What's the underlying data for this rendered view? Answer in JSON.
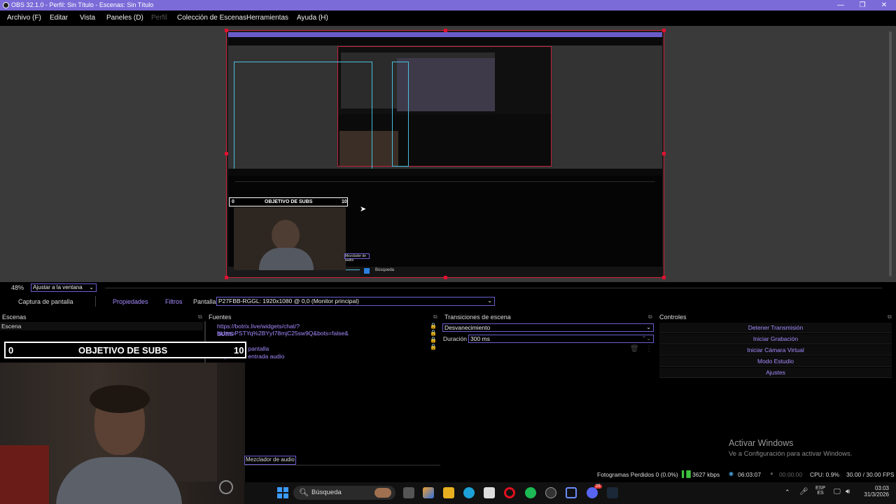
{
  "window": {
    "title": "OBS 32.1.0 - Perfil: Sin Título - Escenas: Sin Título",
    "controls": [
      "—",
      "❐",
      "✕"
    ]
  },
  "menu": [
    "Archivo (F)",
    "Editar",
    "Vista",
    "Paneles (D)",
    "Perfil",
    "Colección de Escenas",
    "Herramientas",
    "Ayuda (H)"
  ],
  "preview": {
    "zoom_percent": "48%",
    "zoom_mode": "Ajustar a la ventana",
    "overlay_widget": {
      "left_value": "0",
      "title": "OBJETIVO DE SUBS",
      "right_value": "10"
    },
    "nested_cursor_label": "Captura de pantalla",
    "nested_mixer_label": "Mezclador de audio",
    "nested_search": "Búsqueda"
  },
  "source_toolbar": {
    "selected_source": "Captura de pantalla",
    "properties": "Propiedades",
    "filters": "Filtros",
    "display_label": "Pantalla",
    "display_value": "P27FBB-RGGL: 1920x1080 @ 0,0 (Monitor principal)"
  },
  "scenes": {
    "header": "Escenas",
    "items": [
      "Escena"
    ]
  },
  "sources": {
    "header": "Fuentes",
    "items": [
      "https://botrix.live/widgets/chat/?bid=soPSTYq%2BYyI78mjC25sw9Q&bots=false&",
      "SUBS",
      "Captura de pantalla",
      "Captura de entrada audio"
    ]
  },
  "transitions": {
    "header": "Transiciones de escena",
    "type": "Desvanecimiento",
    "duration_label": "Duración",
    "duration_value": "300 ms"
  },
  "controls": {
    "header": "Controles",
    "buttons": [
      "Detener Transmisión",
      "Iniciar Grabación",
      "Iniciar Cámara Virtual",
      "Modo Estudio",
      "Ajustes"
    ]
  },
  "webcam_overlay": {
    "left_value": "0",
    "title": "OBJETIVO DE SUBS",
    "right_value": "10"
  },
  "audio_mixer_tab": "Mezclador de audio",
  "activate_windows": {
    "title": "Activar Windows",
    "subtitle": "Ve a Configuración para activar Windows."
  },
  "status_bar": {
    "dropped_frames": "Fotogramas Perdidos 0 (0.0%)",
    "bitrate": "3627 kbps",
    "stream_time": "06:03:07",
    "rec_time": "00:00:00",
    "cpu": "CPU: 0.9%",
    "fps": "30.00 / 30.00 FPS"
  },
  "taskbar": {
    "search_placeholder": "Búsqueda",
    "lang_top": "ESP",
    "lang_bottom": "ES",
    "time": "03:03",
    "date": "31/3/2026",
    "badge": "25"
  },
  "colors": {
    "accent": "#7b6bd8",
    "link": "#a58cff",
    "record": "#e01030"
  }
}
